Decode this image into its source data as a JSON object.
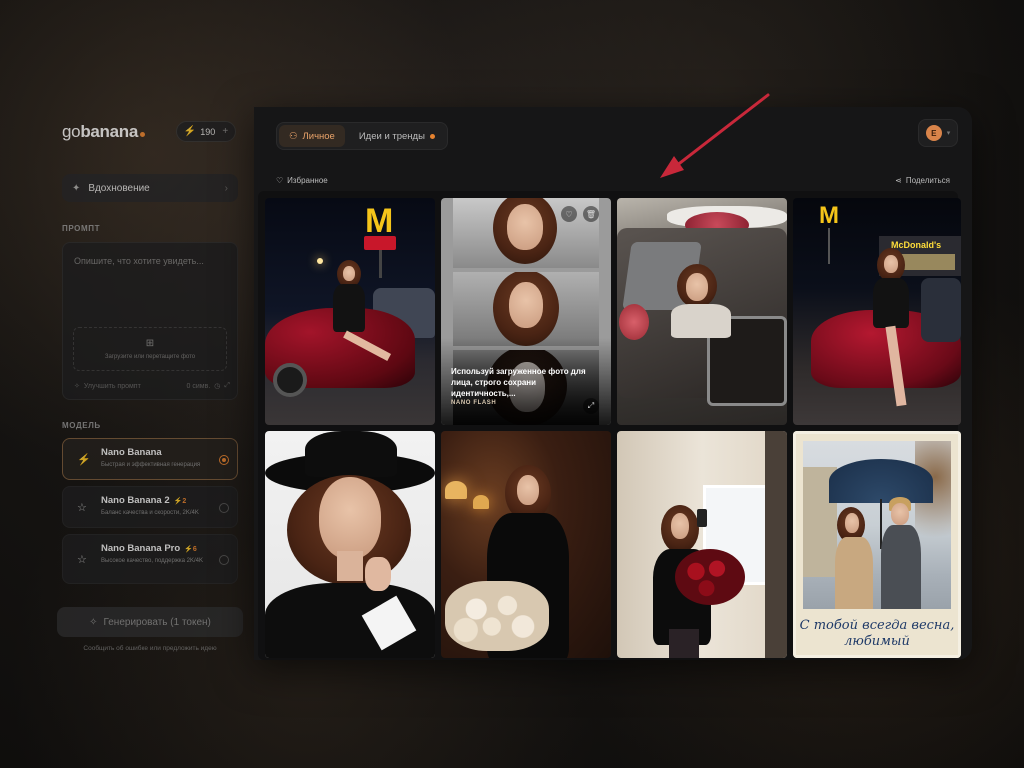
{
  "app": {
    "logo_prefix": "go",
    "logo_bold": "banana",
    "tokens": "190"
  },
  "sidebar": {
    "inspiration_label": "Вдохновение",
    "prompt_section_label": "ПРОМПТ",
    "prompt_placeholder": "Опишите, что хотите увидеть...",
    "upload_hint": "Загрузите или перетащите фото",
    "improve_prompt_label": "Улучшить промпт",
    "char_count": "0 симв.",
    "model_section_label": "МОДЕЛЬ",
    "models": [
      {
        "name": "Nano Banana",
        "cost": "",
        "desc": "Быстрая и эффективная генерация",
        "selected": true
      },
      {
        "name": "Nano Banana 2",
        "cost": "2",
        "desc": "Баланс качества и скорости, 2K/4K",
        "selected": false
      },
      {
        "name": "Nano Banana Pro",
        "cost": "6",
        "desc": "Высокое качество, поддержка 2K/4K",
        "selected": false
      }
    ],
    "generate_label": "Генерировать (1 токен)",
    "report_label": "Сообщить об ошибке или предложить идею"
  },
  "main": {
    "tabs": [
      {
        "label": "Личное",
        "active": true
      },
      {
        "label": "Идеи и тренды",
        "active": false,
        "dot": true
      }
    ],
    "avatar_letter": "E",
    "favorites_label": "Избранное",
    "share_label": "Поделиться"
  },
  "gallery": {
    "tiles": [
      {
        "id": "mcdonalds-car-night-1"
      },
      {
        "id": "portrait-triptych",
        "overlay_text": "Используй загруженное фото для лица, строго сохрани идентичность,...",
        "overlay_tag": "NANO FLASH"
      },
      {
        "id": "vintage-car-roses"
      },
      {
        "id": "mcdonalds-car-night-2",
        "sign_text": "McDonald's"
      },
      {
        "id": "black-hat-portrait"
      },
      {
        "id": "black-dress-roses-restaurant"
      },
      {
        "id": "mirror-selfie-roses"
      },
      {
        "id": "umbrella-postcard",
        "caption_line1": "С тобой всегда весна,",
        "caption_line2": "любимый"
      }
    ]
  },
  "colors": {
    "accent": "#e6822f",
    "panel_bg": "#161617",
    "annotation_arrow": "#c8283a"
  }
}
